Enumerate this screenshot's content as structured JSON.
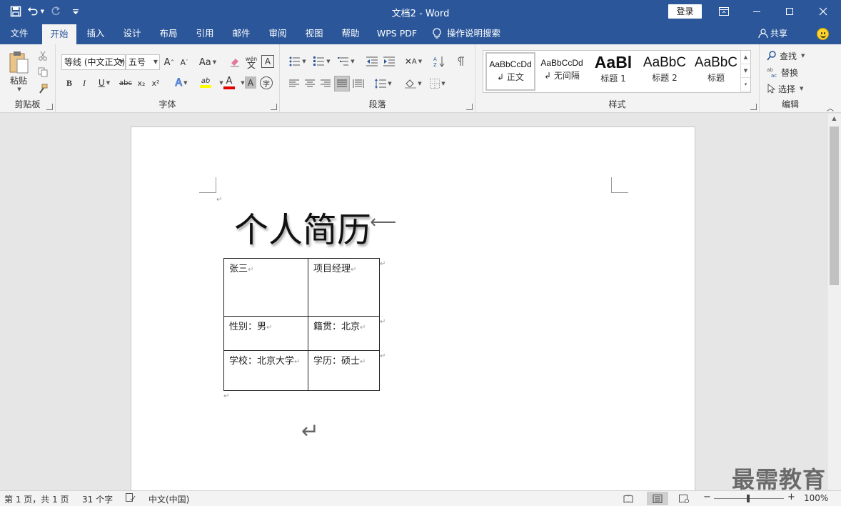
{
  "app": {
    "doc_title": "文档2",
    "separator": "-",
    "app_name": "Word",
    "login_label": "登录"
  },
  "tabs": [
    {
      "label": "文件"
    },
    {
      "label": "开始",
      "active": true
    },
    {
      "label": "插入"
    },
    {
      "label": "设计"
    },
    {
      "label": "布局"
    },
    {
      "label": "引用"
    },
    {
      "label": "邮件"
    },
    {
      "label": "审阅"
    },
    {
      "label": "视图"
    },
    {
      "label": "帮助"
    },
    {
      "label": "WPS PDF"
    },
    {
      "label": "操作说明搜索"
    }
  ],
  "share_label": "共享",
  "ribbon": {
    "clipboard": {
      "paste_label": "粘贴",
      "group_label": "剪贴板"
    },
    "font": {
      "font_name": "等线 (中文正文)",
      "font_size": "五号",
      "group_label": "字体",
      "bold": "B",
      "italic": "I",
      "underline": "U",
      "strike": "abc",
      "subscript": "x₂",
      "superscript": "x²",
      "grow": "A",
      "shrink": "A",
      "case": "Aa",
      "wen": "wén",
      "char_border": "A",
      "highlight": "ab",
      "font_color": "A",
      "shade": "A",
      "enclose": "字"
    },
    "paragraph": {
      "group_label": "段落"
    },
    "styles": {
      "group_label": "样式",
      "items": [
        {
          "preview": "AaBbCcDd",
          "name": "正文",
          "selected": true
        },
        {
          "preview": "AaBbCcDd",
          "name": "无间隔"
        },
        {
          "preview": "AaBl",
          "name": "标题 1"
        },
        {
          "preview": "AaBbC",
          "name": "标题 2"
        },
        {
          "preview": "AaBbC",
          "name": "标题"
        }
      ]
    },
    "editing": {
      "find": "查找",
      "replace": "替换",
      "select": "选择",
      "group_label": "编辑"
    }
  },
  "document": {
    "title": "个人简历",
    "table": [
      [
        "张三",
        "项目经理"
      ],
      [
        "性别：男",
        "籍贯：北京"
      ],
      [
        "学校：北京大学",
        "学历：硕士"
      ]
    ]
  },
  "status": {
    "page": "第 1 页，共 1 页",
    "words": "31 个字",
    "language": "中文(中国)",
    "zoom": "100%",
    "zoom_minus": "−",
    "zoom_plus": "+"
  },
  "watermark": "最需教育",
  "colors": {
    "accent": "#2b579a",
    "ribbon": "#f3f3f3",
    "font_color_bar": "#e00000",
    "highlight_bar": "#ffff00"
  }
}
